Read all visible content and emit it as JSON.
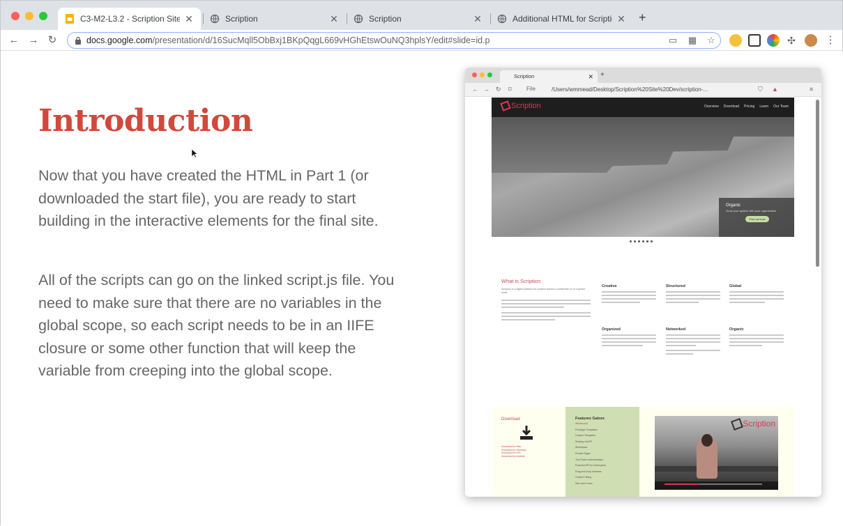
{
  "browser": {
    "tabs": [
      {
        "title": "C3-M2-L3.2 - Scription Site - ",
        "active": true,
        "icon": "google-slides-icon"
      },
      {
        "title": "Scription",
        "active": false,
        "icon": "globe-icon"
      },
      {
        "title": "Scription",
        "active": false,
        "icon": "globe-icon"
      },
      {
        "title": "Additional HTML for Scription",
        "active": false,
        "icon": "globe-icon"
      }
    ],
    "url_host": "docs.google.com",
    "url_path": "/presentation/d/16SucMqll5ObBxj1BKpQqgL669vHGhEtswOuNQ3hplsY/edit#slide=id.p"
  },
  "slide": {
    "heading": "Introduction",
    "paragraph1": "Now that you have created the HTML in Part 1 (or downloaded the start file), you are ready to start building in the interactive elements for the final site.",
    "paragraph2": "All of the scripts can go on the linked script.js file. You need to make sure that there are no variables in the global scope, so each script needs to be in an IIFE closure or some other function that will keep the variable from creeping into the global scope."
  },
  "embedded": {
    "tab_title": "Scription",
    "file_label": "File",
    "url": "/Users/wmmead/Desktop/Scription%20Site%20Dev/scription-...",
    "site": {
      "logo": "Scription",
      "nav": [
        "Overview",
        "Download",
        "Pricing",
        "Learn",
        "Our Team"
      ],
      "hero_heading": "Organic",
      "hero_sub": "Grow your system with your organization",
      "hero_button": "Find out how",
      "what_heading": "What is Scription",
      "what_text": "Scription is a digital platform for creative teams to collaborate on at a global scale.",
      "columns": [
        "Creative",
        "Structured",
        "Global",
        "Organized",
        "Networked",
        "Organic"
      ],
      "download_heading": "Download",
      "download_links": [
        "Download for Mac",
        "Download for Windows",
        "Download for iOS",
        "Download for Android"
      ],
      "features_heading": "Features Galore",
      "features": [
        "Whiteboard",
        "Prototype Templates",
        "Custom Templates",
        "Sharing via API",
        "Workspace",
        "Private Pages",
        "Two Factor Authentication",
        "Powerful API for Developers",
        "Drag and Drop Interface",
        "Content Hiding",
        "See much more"
      ],
      "video_logo": "Scription"
    }
  },
  "colors": {
    "heading": "#d0493c",
    "body_text": "#666666",
    "accent": "#d43c52"
  }
}
